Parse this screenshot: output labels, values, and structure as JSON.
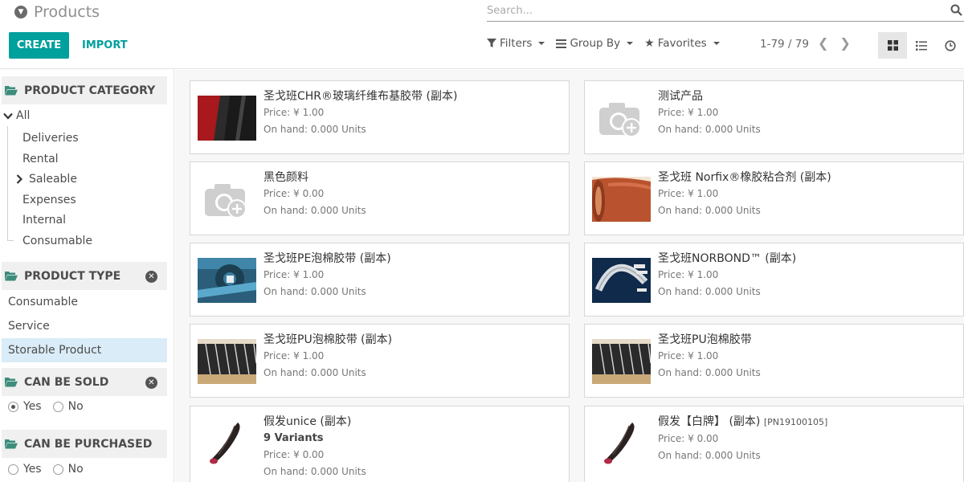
{
  "header": {
    "title": "Products",
    "create_label": "CREATE",
    "import_label": "IMPORT",
    "search_placeholder": "Search...",
    "filters_label": "Filters",
    "groupby_label": "Group By",
    "favorites_label": "Favorites",
    "pager": "1-79 / 79"
  },
  "colors": {
    "accent": "#00a09d",
    "selected_bg": "#d9ecf7"
  },
  "sidebar": {
    "category_title": "PRODUCT CATEGORY",
    "categories": {
      "all": "All",
      "deliveries": "Deliveries",
      "rental": "Rental",
      "saleable": "Saleable",
      "expenses": "Expenses",
      "internal": "Internal",
      "consumable": "Consumable"
    },
    "type_title": "PRODUCT TYPE",
    "types": [
      "Consumable",
      "Service",
      "Storable Product"
    ],
    "can_be_sold_title": "CAN BE SOLD",
    "can_be_purchased_title": "CAN BE PURCHASED",
    "yes": "Yes",
    "no": "No"
  },
  "products": [
    {
      "name": "圣戈班CHR®玻璃纤维布基胶带 (副本)",
      "price": "Price: ¥ 1.00",
      "onhand": "On hand: 0.000 Units",
      "image": "red-black-tape"
    },
    {
      "name": "测试产品",
      "price": "Price: ¥ 1.00",
      "onhand": "On hand: 0.000 Units",
      "image": "camera-placeholder-icon"
    },
    {
      "name": "黑色颜料",
      "price": "Price: ¥ 0.00",
      "onhand": "On hand: 0.000 Units",
      "image": "camera-placeholder-icon"
    },
    {
      "name": "圣戈班 Norfix®橡胶粘合剂 (副本)",
      "price": "Price: ¥ 1.00",
      "onhand": "On hand: 0.000 Units",
      "image": "rubber-roll"
    },
    {
      "name": "圣戈班PE泡棉胶带 (副本)",
      "price": "Price: ¥ 1.00",
      "onhand": "On hand: 0.000 Units",
      "image": "blue-foam-tape"
    },
    {
      "name": "圣戈班NORBOND™ (副本)",
      "price": "Price: ¥ 1.00",
      "onhand": "On hand: 0.000 Units",
      "image": "norbond-tape"
    },
    {
      "name": "圣戈班PU泡棉胶带 (副本)",
      "price": "Price: ¥ 1.00",
      "onhand": "On hand: 0.000 Units",
      "image": "pu-foam-strips"
    },
    {
      "name": "圣戈班PU泡棉胶带",
      "price": "Price: ¥ 1.00",
      "onhand": "On hand: 0.000 Units",
      "image": "pu-foam-strips"
    },
    {
      "name": "假发unice (副本)",
      "variants": "9 Variants",
      "price": "Price: ¥ 0.00",
      "onhand": "On hand: 0.000 Units",
      "image": "hair-bundle"
    },
    {
      "name": "假发【白牌】 (副本)",
      "code": "[PN19100105]",
      "price": "Price: ¥ 0.00",
      "onhand": "On hand: 0.000 Units",
      "image": "hair-bundle"
    }
  ]
}
